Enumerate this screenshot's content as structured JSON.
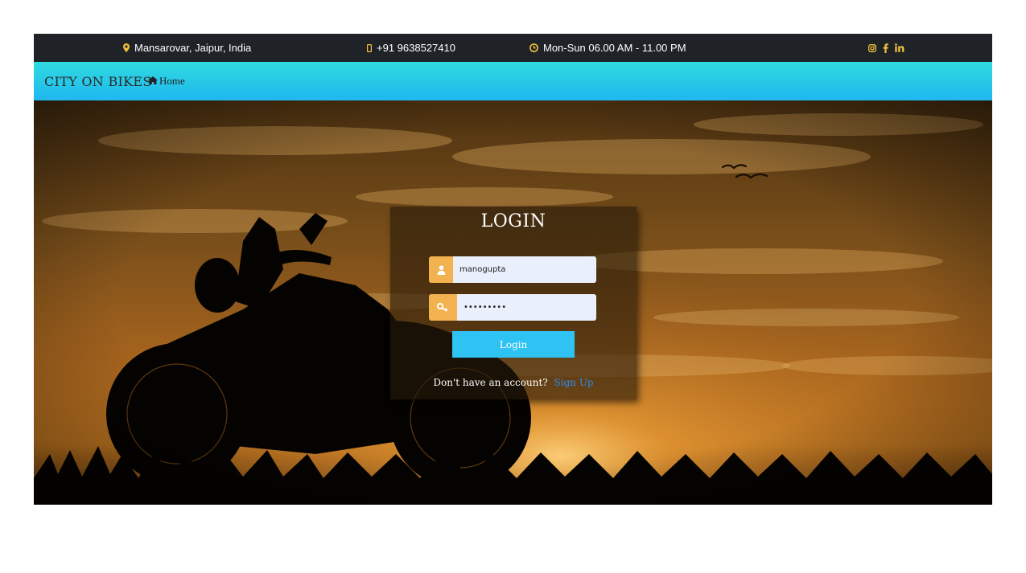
{
  "topbar": {
    "location": "Mansarovar, Jaipur, India",
    "phone": "+91 9638527410",
    "hours": "Mon-Sun 06.00 AM - 11.00 PM",
    "icon_color": "#f2c23a",
    "social_icons": [
      "instagram-icon",
      "facebook-icon",
      "linkedin-icon"
    ]
  },
  "navbar": {
    "brand": "CITY ON BIKES",
    "home_label": "Home"
  },
  "hero": {
    "image": "motorcycle silhouette at sunset"
  },
  "login": {
    "title": "LOGIN",
    "username_value": "manogupta",
    "password_value": "•••••••••",
    "submit_label": "Login",
    "signup_prompt": "Don't have an account?",
    "signup_link": "Sign Up",
    "accent": "#f2b24f",
    "button_color": "#2fc3f3"
  }
}
